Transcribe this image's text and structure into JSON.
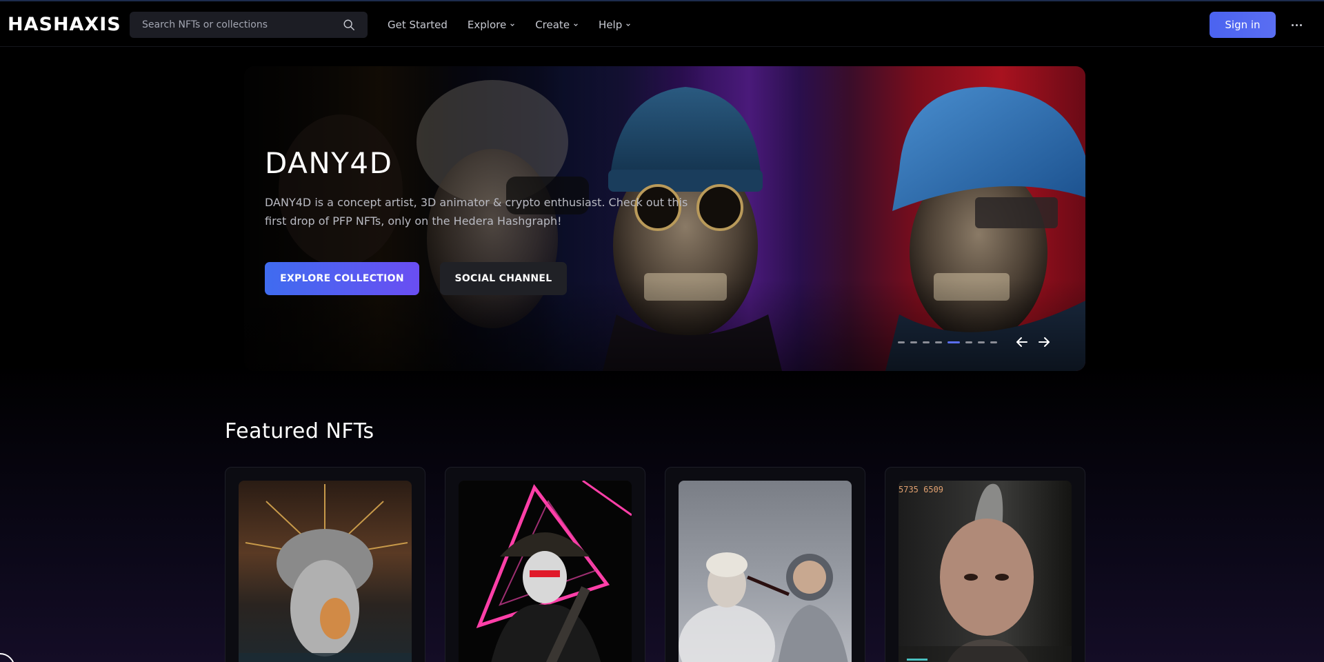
{
  "header": {
    "logo_text": "HASHAXIS",
    "search_placeholder": "Search NFTs or collections",
    "nav": [
      {
        "label": "Get Started",
        "has_dropdown": false
      },
      {
        "label": "Explore",
        "has_dropdown": true
      },
      {
        "label": "Create",
        "has_dropdown": true
      },
      {
        "label": "Help",
        "has_dropdown": true
      }
    ],
    "signin_label": "Sign in"
  },
  "hero": {
    "title": "DANY4D",
    "description": "DANY4D is a concept artist, 3D animator & crypto enthusiast. Check out this first drop of PFP NFTs, only on the Hedera Hashgraph!",
    "primary_button": "EXPLORE COLLECTION",
    "secondary_button": "SOCIAL CHANNEL",
    "slide_count": 8,
    "active_slide": 5
  },
  "featured": {
    "title": "Featured NFTs",
    "cards": [
      {
        "art": "chrome-statue-head"
      },
      {
        "art": "neon-samurai"
      },
      {
        "art": "astronaut-and-statue"
      },
      {
        "art": "mohawk-portrait",
        "overlay_text": "5735 6509"
      }
    ]
  },
  "colors": {
    "accent": "#5a6ef2",
    "background": "#000000",
    "surface": "#1c1d24"
  }
}
